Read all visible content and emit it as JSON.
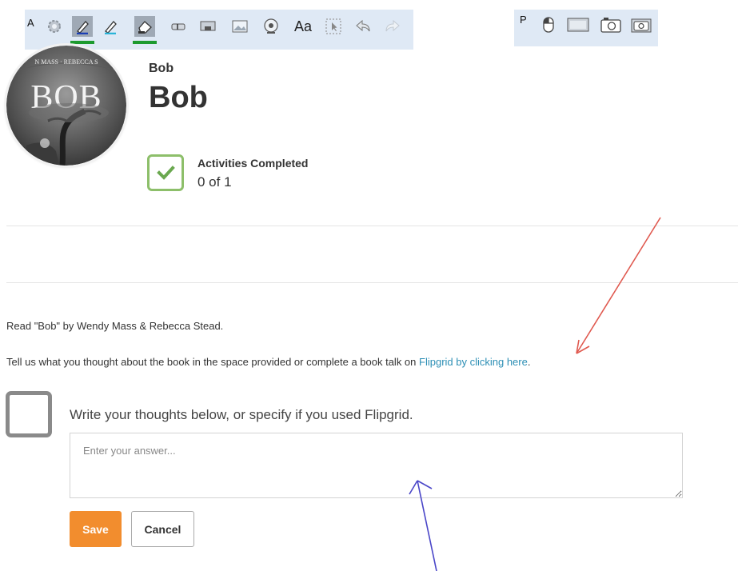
{
  "toolbar_a": {
    "tag": "A",
    "text_tool_label": "Aa",
    "tools": [
      "gear-icon",
      "pen-icon",
      "highlighter-icon",
      "eraser-icon",
      "strikethrough-icon",
      "screenshot-icon",
      "image-icon",
      "webcam-icon",
      "text-icon",
      "select-icon",
      "undo-icon",
      "redo-icon"
    ]
  },
  "toolbar_p": {
    "tag": "P",
    "tools": [
      "mouse-icon",
      "fullscreen-capture-icon",
      "area-capture-icon",
      "camera-icon"
    ]
  },
  "header": {
    "subtitle": "Bob",
    "title": "Bob"
  },
  "book_cover": {
    "authors_line": "N MASS · REBECCA S",
    "title": "BOB"
  },
  "progress": {
    "label": "Activities Completed",
    "count": "0 of 1"
  },
  "content": {
    "instruction": "Read \"Bob\" by Wendy Mass & Rebecca Stead.",
    "prompt_text": "Tell us what you thought about the book in the space provided or complete a book talk on ",
    "link_text": "Flipgrid by clicking here",
    "prompt_end": "."
  },
  "task": {
    "question": "Write your thoughts below, or specify if you used Flipgrid.",
    "answer_value": "",
    "answer_placeholder": "Enter your answer..."
  },
  "buttons": {
    "save": "Save",
    "cancel": "Cancel"
  },
  "colors": {
    "accent_orange": "#f28d2e",
    "check_green": "#8dbf6a",
    "link_blue": "#2d8fb5",
    "annotation_red": "#e05a50",
    "annotation_blue": "#4a46c8",
    "toolbar_bg": "#dfe9f5",
    "tool_selected_underline": "#1d9a2e"
  }
}
